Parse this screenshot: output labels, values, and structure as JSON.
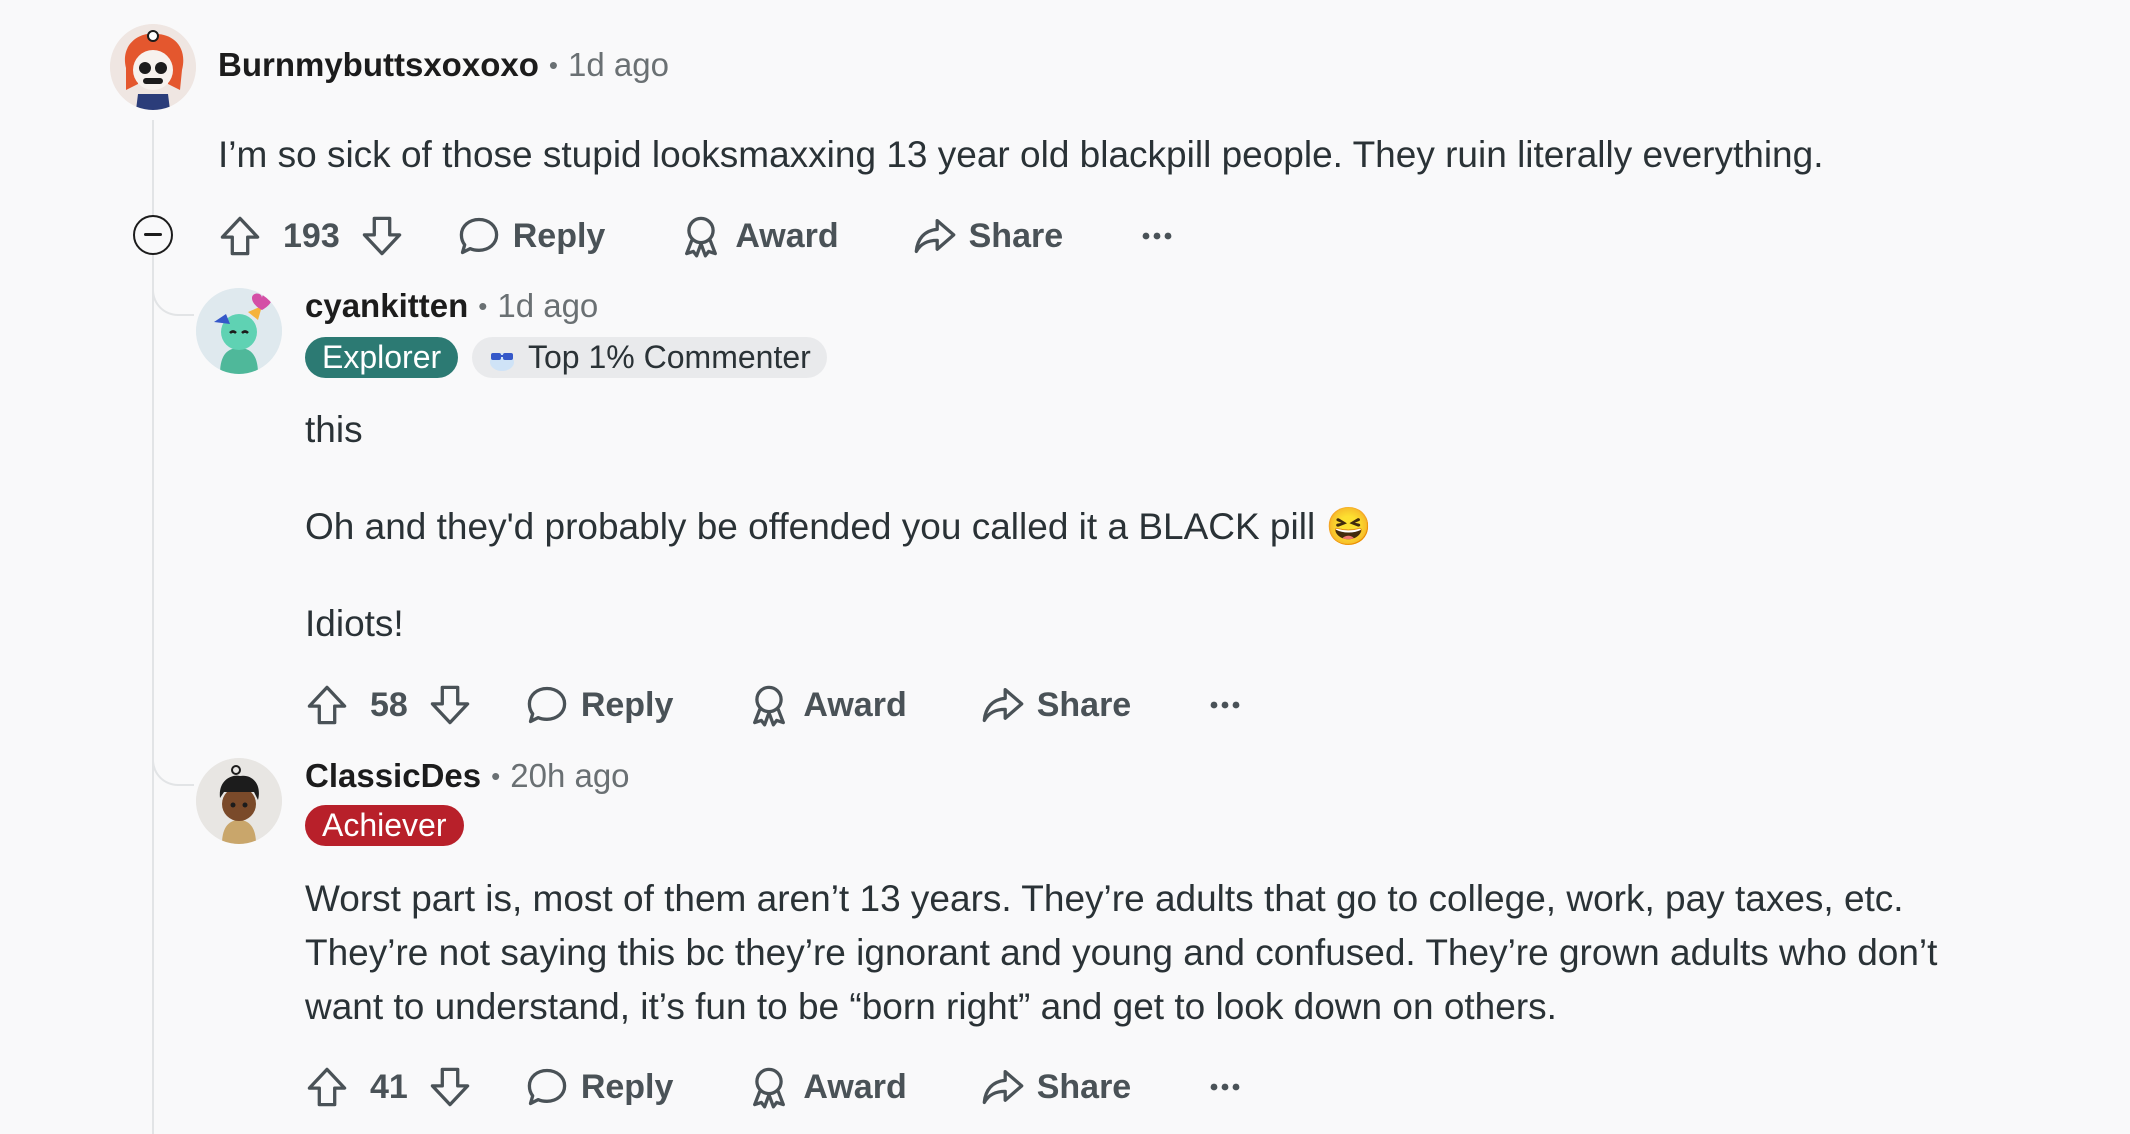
{
  "comments": [
    {
      "author": "Burnmybuttsxoxoxo",
      "separator": "•",
      "time": "1d ago",
      "body": [
        "I’m so sick of those stupid looksmaxxing 13 year old blackpill people. They ruin literally everything."
      ],
      "score": "193",
      "reply": "Reply",
      "award": "Award",
      "share": "Share",
      "more": "•••"
    },
    {
      "author": "cyankitten",
      "separator": "•",
      "time": "1d ago",
      "flair": "Explorer",
      "flair_color": "#2c7a73",
      "badge": "Top 1% Commenter",
      "body": [
        "this",
        "Oh and they'd probably be offended you called it a BLACK pill 😆",
        "Idiots!"
      ],
      "score": "58",
      "reply": "Reply",
      "award": "Award",
      "share": "Share",
      "more": "•••"
    },
    {
      "author": "ClassicDes",
      "separator": "•",
      "time": "20h ago",
      "flair": "Achiever",
      "flair_color": "#b8202a",
      "body": [
        "Worst part is, most of them aren’t 13 years. They’re adults that go to college, work, pay taxes, etc.",
        "They’re not saying this bc they’re ignorant and young and confused. They’re grown adults who don’t",
        "want to understand, it’s fun to be “born right” and get to look down on others."
      ],
      "score": "41",
      "reply": "Reply",
      "award": "Award",
      "share": "Share",
      "more": "•••"
    }
  ]
}
